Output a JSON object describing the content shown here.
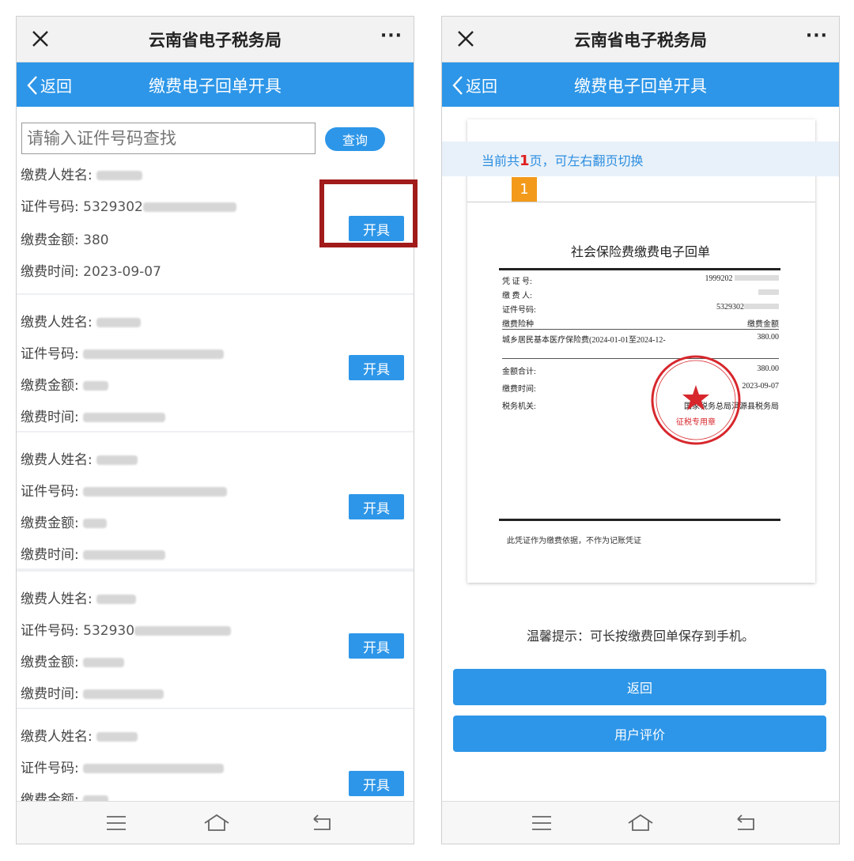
{
  "left": {
    "titlebar": {
      "title": "云南省电子税务局",
      "more": "···"
    },
    "navbar": {
      "back": "返回",
      "title": "缴费电子回单开具"
    },
    "search": {
      "placeholder": "请输入证件号码查找",
      "button": "查询"
    },
    "records": [
      {
        "name_label": "缴费人姓名:",
        "id_label": "证件号码:",
        "id_value": "5329302",
        "amount_label": "缴费金额:",
        "amount_value": "380",
        "time_label": "缴费时间:",
        "time_value": "2023-09-07",
        "button": "开具"
      },
      {
        "name_label": "缴费人姓名:",
        "id_label": "证件号码:",
        "amount_label": "缴费金额:",
        "time_label": "缴费时间:",
        "button": "开具"
      },
      {
        "name_label": "缴费人姓名:",
        "id_label": "证件号码:",
        "amount_label": "缴费金额:",
        "time_label": "缴费时间:",
        "button": "开具"
      },
      {
        "name_label": "缴费人姓名:",
        "id_label": "证件号码:",
        "id_value": "532930",
        "amount_label": "缴费金额:",
        "time_label": "缴费时间:",
        "button": "开具"
      },
      {
        "name_label": "缴费人姓名:",
        "id_label": "证件号码:",
        "amount_label": "缴费金额:",
        "button": "开具"
      }
    ]
  },
  "right": {
    "titlebar": {
      "title": "云南省电子税务局",
      "more": "···"
    },
    "navbar": {
      "back": "返回",
      "title": "缴费电子回单开具"
    },
    "pagebar": {
      "prefix": "当前共",
      "count": "1",
      "suffix": "页，可左右翻页切换",
      "chip": "1"
    },
    "receipt": {
      "title": "社会保险费缴费电子回单",
      "voucher_label": "凭 证 号:",
      "voucher_value": "1999202",
      "payer_label": "缴 费 人:",
      "id_label": "证件号码:",
      "id_value": "5329302",
      "type_label": "缴费险种",
      "amount_header": "缴费金额",
      "item_text": "城乡居民基本医疗保险费(2024-01-01至2024-12-",
      "item_amount": "380.00",
      "total_label": "金额合计:",
      "total_value": "380.00",
      "time_label": "缴费时间:",
      "time_value": "2023-09-07",
      "office_label": "税务机关:",
      "office_value": "国家税务总局洱源县税务局",
      "stamp_top": "国家税务总局洱源县税务局",
      "stamp_bottom": "征税专用章",
      "note": "此凭证作为缴费依据，不作为记账凭证"
    },
    "tip": "温馨提示：可长按缴费回单保存到手机。",
    "buttons": {
      "back": "返回",
      "rate": "用户评价"
    }
  },
  "colors": {
    "accent": "#2d96e8",
    "highlight": "#a11b1b",
    "chip": "#f39a1a",
    "stamp": "#d7272d"
  },
  "icons": [
    "close-icon",
    "more-icon",
    "chevron-left-icon",
    "menu-icon",
    "home-icon",
    "back-arrow-icon"
  ]
}
